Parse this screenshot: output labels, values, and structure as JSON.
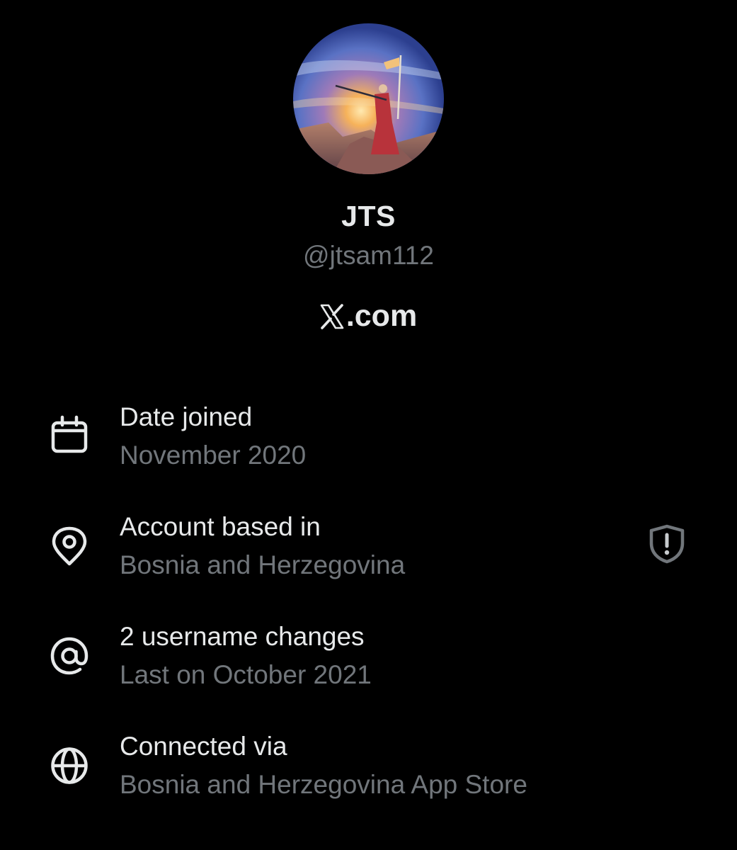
{
  "profile": {
    "display_name": "JTS",
    "handle": "@jtsam112",
    "avatar_description_icon": "avatar-painting"
  },
  "brand": {
    "suffix": ".com",
    "icon": "x-logo-icon"
  },
  "about": {
    "items": [
      {
        "icon": "calendar-icon",
        "label": "Date joined",
        "value": "November 2020"
      },
      {
        "icon": "location-pin-icon",
        "label": "Account based in",
        "value": "Bosnia and Herzegovina",
        "trailing_icon": "shield-alert-icon"
      },
      {
        "icon": "at-sign-icon",
        "label": "2 username changes",
        "value": "Last on October 2021"
      },
      {
        "icon": "globe-icon",
        "label": "Connected via",
        "value": "Bosnia and Herzegovina App Store"
      }
    ]
  },
  "colors": {
    "background": "#000000",
    "primary_text": "#e7e9ea",
    "secondary_text": "#71767b"
  }
}
